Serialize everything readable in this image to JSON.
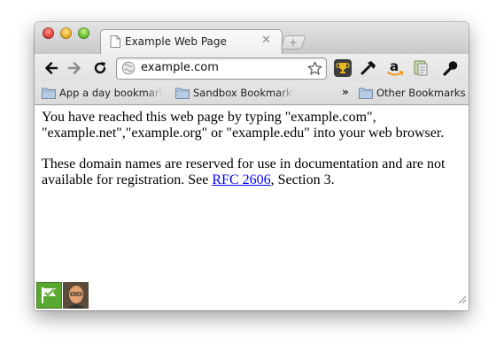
{
  "tab": {
    "title": "Example Web Page",
    "close_glyph": "✕",
    "new_tab_glyph": "+"
  },
  "toolbar": {
    "url": "example.com"
  },
  "bookmarks_bar": {
    "items": [
      {
        "label": "App a day bookmarklet",
        "icon": "folder-icon"
      },
      {
        "label": "Sandbox Bookmarklet",
        "icon": "folder-icon"
      }
    ],
    "overflow_glyph": "»",
    "other": {
      "label": "Other Bookmarks",
      "icon": "folder-icon"
    }
  },
  "page": {
    "para1": "You have reached this web page by typing \"example.com\", \"example.net\",\"example.org\" or \"example.edu\" into your web browser.",
    "para2_before": "These domain names are reserved for use in documentation and are not available for registration. See ",
    "para2_link": "RFC 2606",
    "para2_after": ", Section 3."
  },
  "colors": {
    "link": "#0000ee",
    "window_chrome": "#d6d6d6"
  }
}
